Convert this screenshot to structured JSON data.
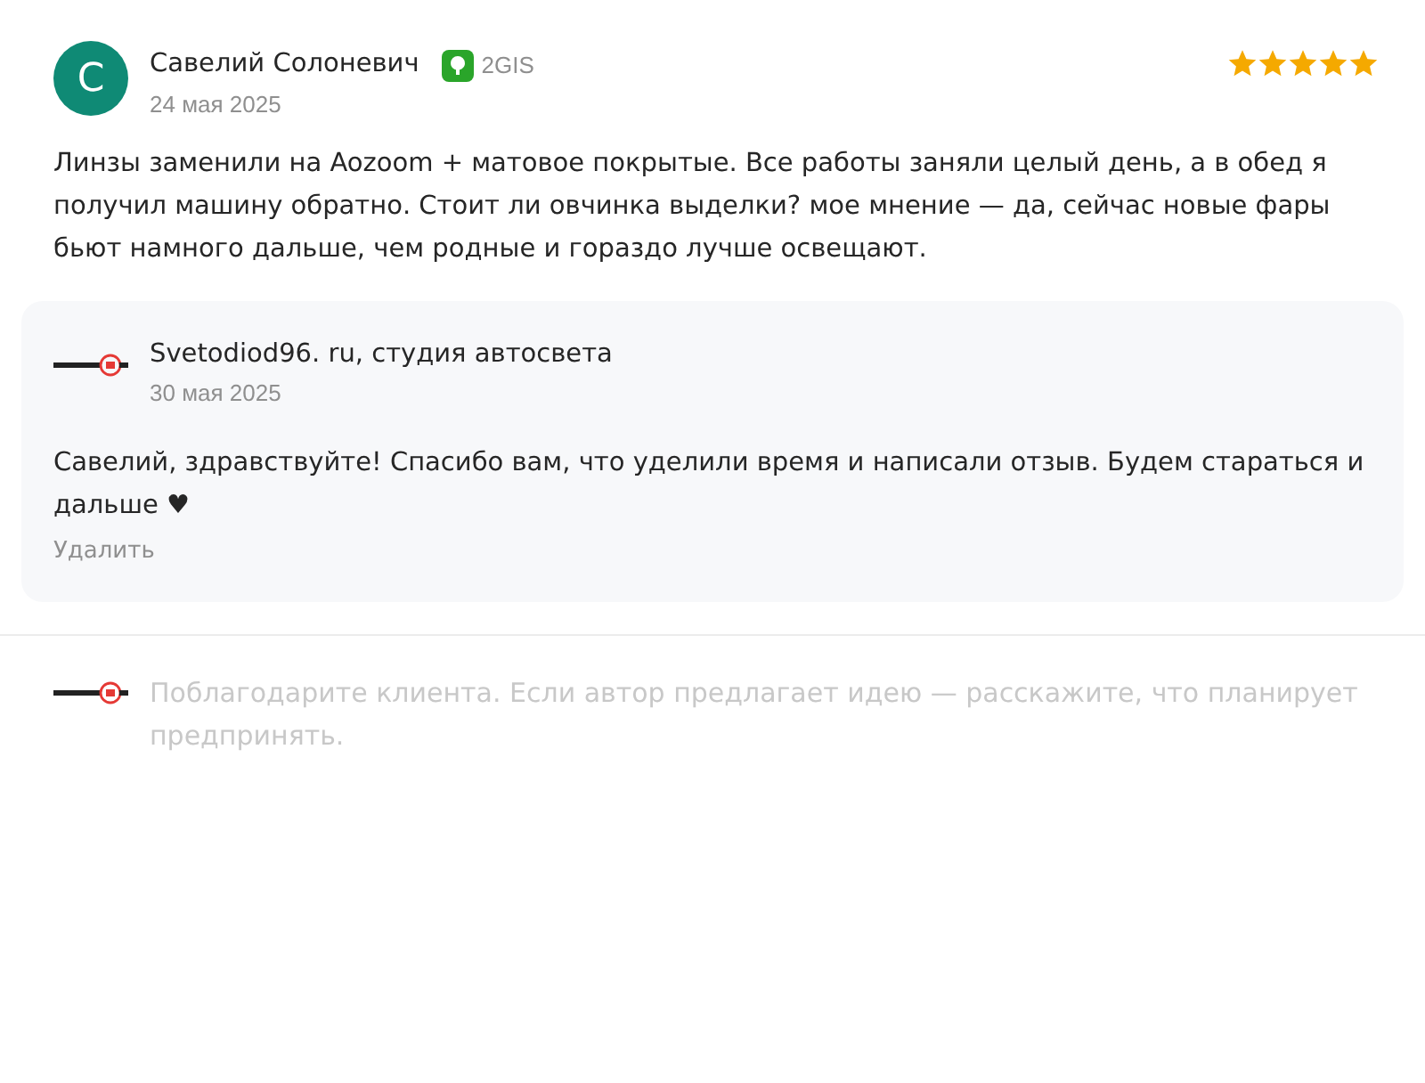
{
  "review": {
    "avatar_letter": "С",
    "author": "Савелий Солоневич",
    "source": "2GIS",
    "date": "24 мая 2025",
    "stars": 5,
    "text": "Линзы заменили на Aozoom + матовое покрытые. Все работы заняли целый день, а в обед я получил машину обратно. Стоит ли овчинка выделки? мое мнение — да, сейчас новые фары бьют намного дальше, чем родные и гораздо лучше освещают."
  },
  "reply": {
    "author": "Svetodiod96. ru, студия автосвета",
    "date": "30 мая 2025",
    "text": "Савелий, здравствуйте! Спасибо вам, что уделили время и написали отзыв. Будем стараться и дальше ♥",
    "delete_label": "Удалить"
  },
  "reply_field": {
    "placeholder": "Поблагодарите клиента. Если автор предлагает идею — расскажите, что планирует предпринять."
  }
}
